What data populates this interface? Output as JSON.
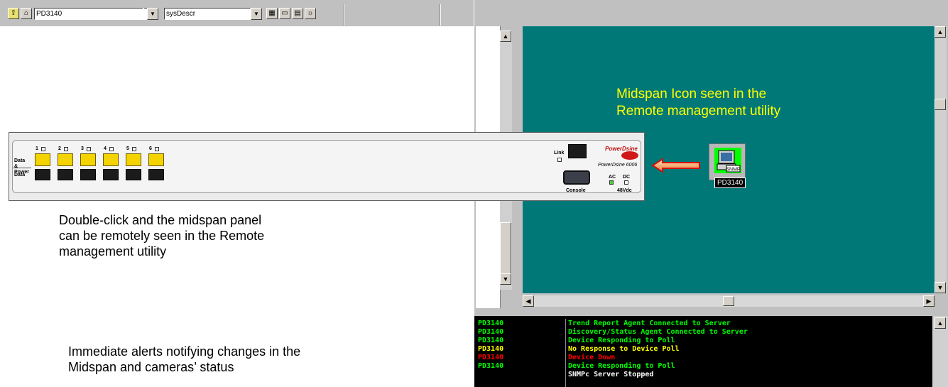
{
  "toolbar": {
    "device_select": "PD3140",
    "mib_select": "sysDescr"
  },
  "map": {
    "annotation": "Midspan Icon seen in the\nRemote management utility",
    "device_badge": "SNMP",
    "device_caption": "PD3140"
  },
  "panel": {
    "port_numbers": [
      "1",
      "2",
      "3",
      "4",
      "5",
      "6"
    ],
    "data_power_label": "Data & Power",
    "data_label": "Data",
    "link_label": "Link",
    "console_label": "Console",
    "brand": "PowerDsine",
    "model": "PowerDsine 6006",
    "ac_label": "AC",
    "dc_label": "DC",
    "voltage_label": "48Vdc"
  },
  "captions": {
    "double_click": "Double-click and the midspan panel\ncan be remotely seen in the Remote\nmanagement utility",
    "alerts": "Immediate alerts notifying changes in the\nMidspan and cameras’ status"
  },
  "log": {
    "rows": [
      {
        "device": "PD3140",
        "message": "Trend Report Agent Connected to Server",
        "color": "#00ff00"
      },
      {
        "device": "PD3140",
        "message": "Discovery/Status Agent Connected to Server",
        "color": "#00ff00"
      },
      {
        "device": "PD3140",
        "message": "Device Responding to Poll",
        "color": "#00ff00"
      },
      {
        "device": "PD3140",
        "message": "No Response to Device Poll",
        "color": "#ffff00"
      },
      {
        "device": "PD3140",
        "message": "Device Down",
        "color": "#ff0000"
      },
      {
        "device": "PD3140",
        "message": "Device Responding to Poll",
        "color": "#00ff00"
      },
      {
        "device": "",
        "message": "SNMPc Server Stopped",
        "color": "#ffffff"
      }
    ]
  },
  "colors": {
    "map_background": "#007878",
    "annotation": "#ffff00",
    "alert_arrow": "#e03010"
  }
}
